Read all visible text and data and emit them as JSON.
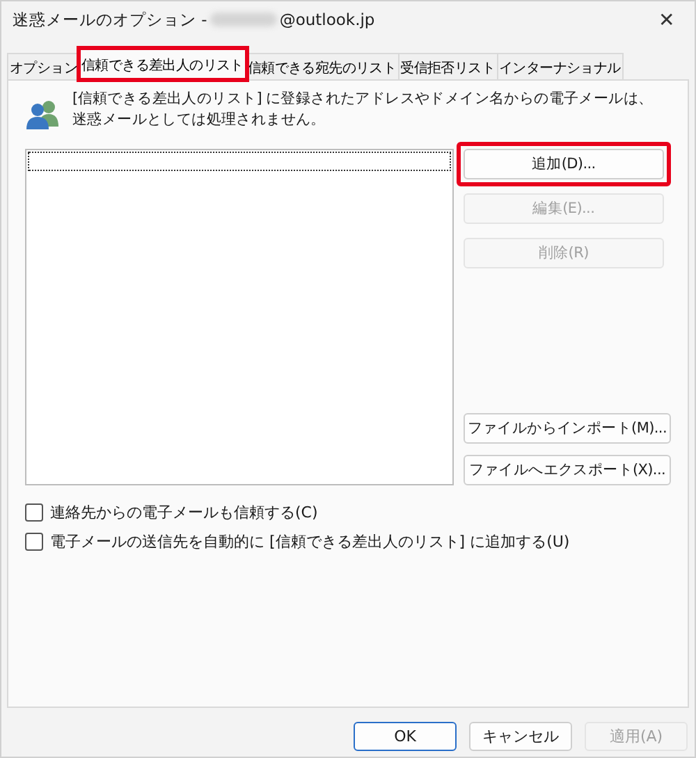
{
  "window": {
    "title": "迷惑メールのオプション - ",
    "title_suffix": "@outlook.jp",
    "close": "✕"
  },
  "tabs": [
    {
      "label": "オプション",
      "selected": false,
      "highlighted": false
    },
    {
      "label": "信頼できる差出人のリスト",
      "selected": true,
      "highlighted": true
    },
    {
      "label": "信頼できる宛先のリスト",
      "selected": false,
      "highlighted": false
    },
    {
      "label": "受信拒否リスト",
      "selected": false,
      "highlighted": false
    },
    {
      "label": "インターナショナル",
      "selected": false,
      "highlighted": false
    }
  ],
  "description": "[信頼できる差出人のリスト] に登録されたアドレスやドメイン名からの電子メールは、迷惑メールとしては処理されません。",
  "side_buttons_top": [
    {
      "label": "追加(D)...",
      "disabled": false,
      "highlighted": true
    },
    {
      "label": "編集(E)...",
      "disabled": true,
      "highlighted": false
    },
    {
      "label": "削除(R)",
      "disabled": true,
      "highlighted": false
    }
  ],
  "side_buttons_bottom": [
    {
      "label": "ファイルからインポート(M)...",
      "disabled": false
    },
    {
      "label": "ファイルへエクスポート(X)...",
      "disabled": false
    }
  ],
  "checkboxes": [
    {
      "label": "連絡先からの電子メールも信頼する(C)",
      "checked": false
    },
    {
      "label": "電子メールの送信先を自動的に [信頼できる差出人のリスト] に追加する(U)",
      "checked": false
    }
  ],
  "footer_buttons": [
    {
      "label": "OK",
      "disabled": false,
      "default": true
    },
    {
      "label": "キャンセル",
      "disabled": false,
      "default": false
    },
    {
      "label": "適用(A)",
      "disabled": true,
      "default": false
    }
  ]
}
